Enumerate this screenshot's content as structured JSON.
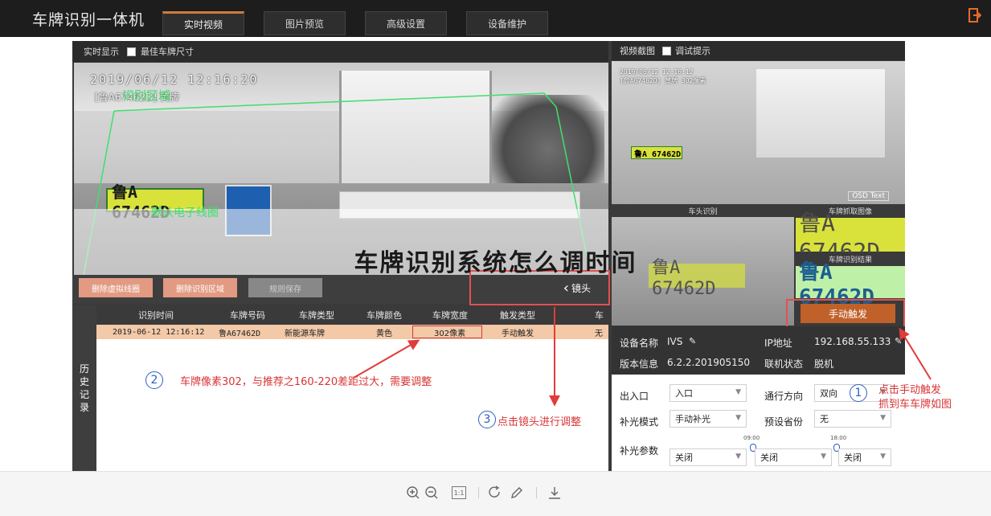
{
  "app": {
    "title": "车牌识别一体机"
  },
  "tabs": [
    {
      "label": "实时视频",
      "active": true
    },
    {
      "label": "图片预览",
      "active": false
    },
    {
      "label": "高级设置",
      "active": false
    },
    {
      "label": "设备维护",
      "active": false
    }
  ],
  "live": {
    "header": "实时显示",
    "checkbox_label": "最佳车牌尺寸",
    "osd_time": "2019/06/12  12:16:20",
    "osd_plate": "[鲁A67462D]  黄牌",
    "zone_label": "识别区域",
    "plate_text": "鲁A 67462D",
    "virtual_line_label": "默认电子线圈"
  },
  "controls": {
    "delete_line": "删除虚拟线圈",
    "delete_zone": "删除识别区域",
    "save_rules": "规则保存",
    "lens": "镜头"
  },
  "overlay_title": "车牌识别系统怎么调时间",
  "history": {
    "side_label": [
      "历",
      "史",
      "记",
      "录"
    ],
    "columns": [
      "识别时间",
      "车牌号码",
      "车牌类型",
      "车牌颜色",
      "车牌宽度",
      "触发类型",
      "车"
    ],
    "rows": [
      {
        "time": "2019-06-12 12:16:12",
        "plate": "鲁A67462D",
        "type": "新能源车牌",
        "color": "黄色",
        "width": "302像素",
        "trigger": "手动触发",
        "extra": "无"
      }
    ]
  },
  "annotations": {
    "note1": {
      "num": "1",
      "line1": "点击手动触发",
      "line2": "抓到车车牌如图"
    },
    "note2": {
      "num": "2",
      "text": "车牌像素302，与推荐之160-220差距过大，需要调整"
    },
    "note3": {
      "num": "3",
      "text": "点击镜头进行调整"
    }
  },
  "snapshot": {
    "header": "视频截图",
    "checkbox_label": "调试提示",
    "osd_line1": "2019/06/12  12:16:12",
    "osd_line2": "[鲁A67462D] 黄牌 302像素",
    "plate": "鲁A 67462D",
    "osd_text": "OSD Text"
  },
  "head_caption": "车头识别",
  "head_plate": "鲁A 67462D",
  "crop_caption": "车牌抓取图像",
  "crop_plate": "鲁A 67462D",
  "result_caption": "车牌识别结果",
  "result_plate": "鲁A 67462D",
  "manual_trigger": "手动触发",
  "device": {
    "name_label": "设备名称",
    "name_value": "IVS",
    "ip_label": "IP地址",
    "ip_value": "192.168.55.133",
    "version_label": "版本信息",
    "version_value": "6.2.2.201905150",
    "status_label": "联机状态",
    "status_value": "脱机"
  },
  "form": {
    "gate_label": "出入口",
    "gate_value": "入口",
    "direction_label": "通行方向",
    "direction_value": "双向",
    "light_label": "补光模式",
    "light_value": "手动补光",
    "province_label": "预设省份",
    "province_value": "无",
    "param_label": "补光参数",
    "param_values": [
      "关闭",
      "关闭",
      "关闭"
    ],
    "time_marks": [
      "09:00",
      "18:00"
    ]
  },
  "toolbar": {
    "icons": [
      "zoom-in-icon",
      "zoom-out-icon",
      "actual-size-icon",
      "rotate-icon",
      "edit-icon",
      "download-icon"
    ],
    "actual_size_label": "1:1"
  },
  "colors": {
    "header_bg": "#1d1d1d",
    "accent": "#c0612a",
    "annotation_red": "#d93434",
    "annotation_blue": "#2d5fc0",
    "plate_yellow": "#d8e23b"
  }
}
